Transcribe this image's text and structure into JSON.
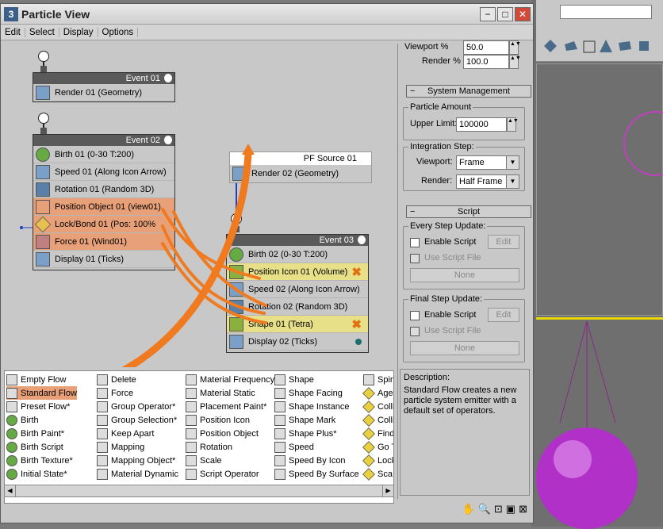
{
  "window": {
    "title": "Particle View",
    "min": "−",
    "max": "□",
    "close": "✕"
  },
  "menu": [
    "Edit",
    "Select",
    "Display",
    "Options"
  ],
  "events": {
    "event01": {
      "title": "Event 01",
      "ops": [
        "Render 01 (Geometry)"
      ]
    },
    "event02": {
      "title": "Event 02",
      "ops": [
        "Birth 01 (0-30 T:200)",
        "Speed 01 (Along Icon Arrow)",
        "Rotation 01 (Random 3D)",
        "Position Object 01 (view01)",
        "Lock/Bond 01 (Pos: 100%",
        "Force 01 (Wind01)",
        "Display 01 (Ticks)"
      ]
    },
    "pfsource": {
      "title": "PF Source 01",
      "ops": [
        "Render 02 (Geometry)"
      ]
    },
    "event03": {
      "title": "Event 03",
      "ops": [
        "Birth 02 (0-30 T:200)",
        "Position Icon 01 (Volume)",
        "Speed 02 (Along Icon Arrow)",
        "Rotation 02 (Random 3D)",
        "Shape 01 (Tetra)",
        "Display 02 (Ticks)"
      ]
    }
  },
  "depot": {
    "col1": [
      "Empty Flow",
      "Standard Flow",
      "Preset Flow*",
      "Birth",
      "Birth Paint*",
      "Birth Script",
      "Birth Texture*",
      "Initial State*"
    ],
    "col2": [
      "Delete",
      "Force",
      "Group Operator*",
      "Group Selection*",
      "Keep Apart",
      "Mapping",
      "Mapping Object*",
      "Material Dynamic"
    ],
    "col3": [
      "Material Frequency",
      "Material Static",
      "Placement Paint*",
      "Position Icon",
      "Position Object",
      "Rotation",
      "Scale",
      "Script Operator"
    ],
    "col4": [
      "Shape",
      "Shape Facing",
      "Shape Instance",
      "Shape Mark",
      "Shape Plus*",
      "Speed",
      "Speed By Icon",
      "Speed By Surface"
    ],
    "col5": [
      "Spin",
      "Age",
      "Colli",
      "Colli",
      "Find",
      "Go T",
      "Lock",
      "Sca"
    ]
  },
  "panel": {
    "viewport_pct_label": "Viewport %",
    "viewport_pct": "50.0",
    "render_pct_label": "Render %",
    "render_pct": "100.0",
    "sysman": "System Management",
    "particle_amount": "Particle Amount",
    "upper_limit_label": "Upper Limit:",
    "upper_limit": "100000",
    "integration_step": "Integration Step:",
    "int_viewport_label": "Viewport:",
    "int_viewport": "Frame",
    "int_render_label": "Render:",
    "int_render": "Half Frame",
    "script": "Script",
    "every_step": "Every Step Update:",
    "final_step": "Final Step Update:",
    "enable_script": "Enable Script",
    "edit": "Edit",
    "use_script_file": "Use Script File",
    "none": "None",
    "description_label": "Description:",
    "description": "Standard Flow creates a new particle system emitter with a default set of operators."
  },
  "colors": {
    "highlight": "#e8a079",
    "accent": "#f07a20"
  }
}
